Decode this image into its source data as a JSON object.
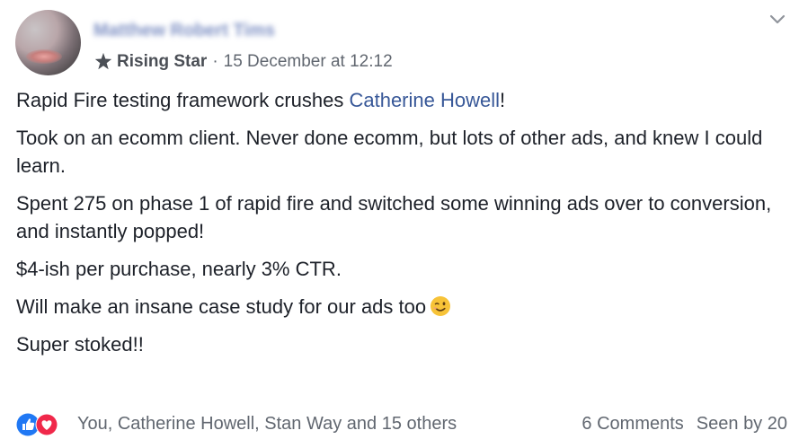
{
  "post": {
    "author_name": "Matthew Robert Tims",
    "badge": "Rising Star",
    "separator": "·",
    "timestamp": "15 December at 12:12",
    "paragraphs": {
      "p1_before": "Rapid Fire testing framework crushes ",
      "p1_link": "Catherine Howell",
      "p1_after": "!",
      "p2": "Took on an ecomm client. Never done ecomm, but lots of other ads, and knew I could learn.",
      "p3": "Spent 275 on phase 1 of rapid fire and switched some winning ads over to conversion, and instantly popped!",
      "p4": "$4-ish per purchase, nearly 3% CTR.",
      "p5": "Will make an insane case study for our ads too",
      "p6": "Super stoked!!"
    },
    "reactions_text": "You, Catherine Howell, Stan Way and 15 others",
    "comments": "6 Comments",
    "seen_by": "Seen by 20"
  },
  "icons": {
    "options": "chevron-down-icon",
    "badge": "star-badge-icon",
    "emoji": "winking-face-emoji",
    "like": "like-icon",
    "love": "love-icon"
  },
  "colors": {
    "link": "#385898",
    "meta": "#616770",
    "like": "#2078f4",
    "love": "#f0284a",
    "emoji": "#f7c338"
  }
}
